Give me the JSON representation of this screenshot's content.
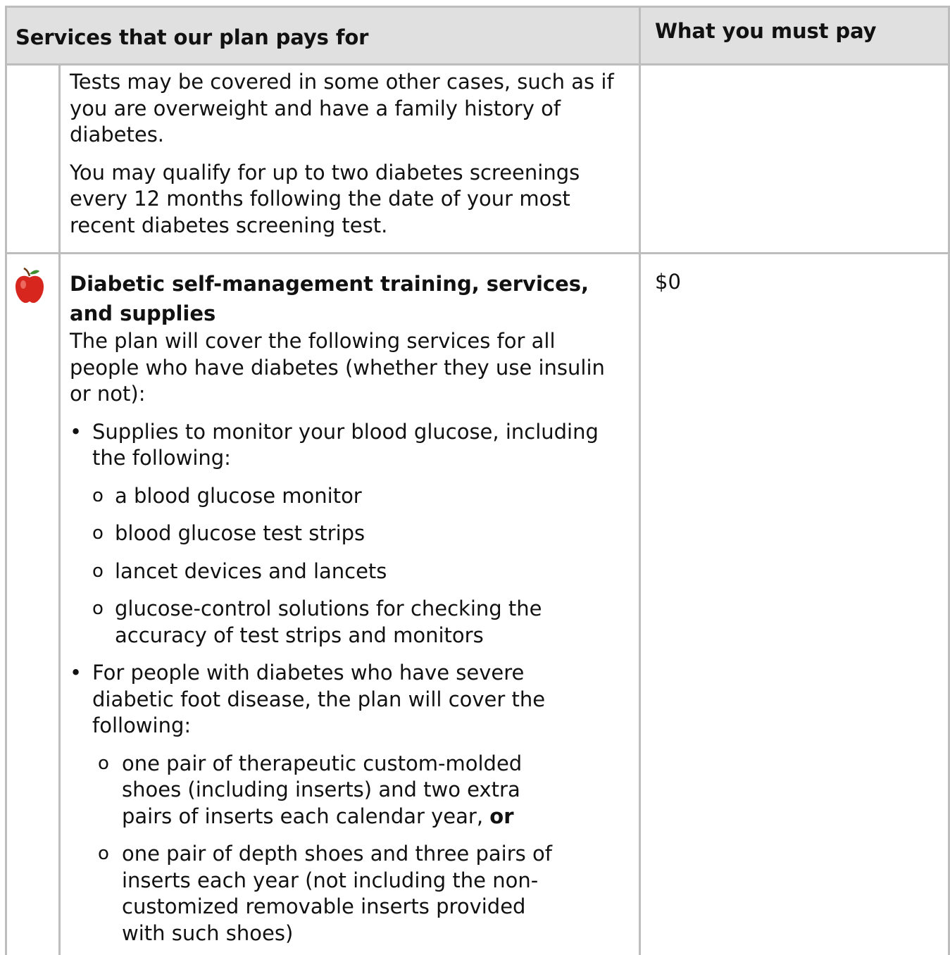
{
  "header": {
    "col1": "Services that our plan pays for",
    "col2": "What you must pay"
  },
  "row1": {
    "p1": "Tests may be covered in some other cases, such as if you are overweight and have a family history of diabetes.",
    "p2": "You may qualify for up to two diabetes screenings every 12 months following the date of your most recent diabetes screening test."
  },
  "row2": {
    "icon": "apple-icon",
    "title": "Diabetic self-management training, services, and supplies",
    "intro": "The plan will cover the following services for all people who have diabetes (whether they use insulin or not):",
    "bullet1": "Supplies to monitor your blood glucose, including the following:",
    "sub1": [
      "a blood glucose monitor",
      "blood glucose test strips",
      "lancet devices and lancets",
      "glucose-control solutions for checking the accuracy of test strips and monitors"
    ],
    "bullet2": "For people with diabetes who have severe diabetic foot disease, the plan will cover the following:",
    "sub2a": "one pair of therapeutic custom-molded shoes (including inserts) and two extra pairs of inserts each calendar year,",
    "sub2a_bold": "or",
    "sub2b": "one pair of depth shoes and three pairs of inserts each year (not including the non-customized removable inserts provided with such shoes)",
    "pay": "$0"
  },
  "markers": {
    "bullet": "•",
    "circle": "o"
  }
}
